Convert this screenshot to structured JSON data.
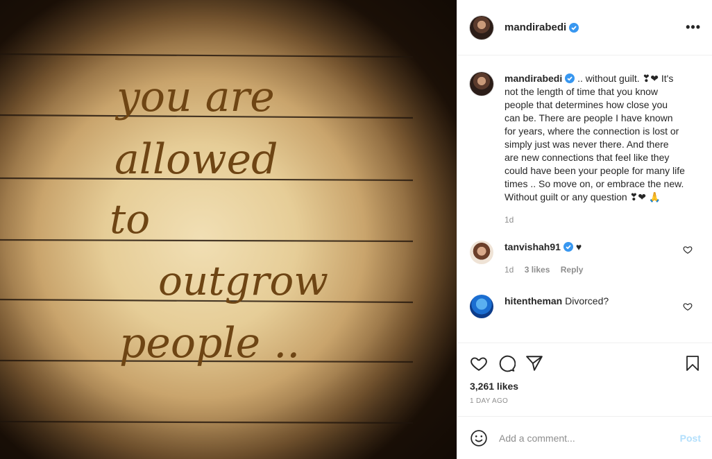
{
  "post": {
    "author": "mandirabedi",
    "more_label": "•••",
    "handwriting": [
      "you are",
      "allowed",
      "to",
      "outgrow",
      "people .."
    ],
    "caption": {
      "author": "mandirabedi",
      "text": " .. without guilt. ❣❤ It's not the length of time that you know people that determines how close you can be. There are people I have known for years, where the connection is lost or simply just was never there. And there are new connections that feel like they could have been your people for many life times .. So move on, or embrace the new. Without guilt or any question ❣❤ 🙏",
      "time": "1d"
    },
    "comments": [
      {
        "user": "tanvishah91",
        "text": " ♥",
        "time": "1d",
        "likes": "3 likes",
        "reply": "Reply"
      },
      {
        "user": "hitentheman",
        "text": " Divorced?"
      }
    ],
    "likes": "3,261 likes",
    "ago": "1 DAY AGO",
    "add_comment": {
      "placeholder": "Add a comment...",
      "post_label": "Post"
    }
  },
  "colors": {
    "verified": "#3897f0",
    "post_disabled": "#b2dffc",
    "muted": "#8e8e8e"
  },
  "icons": [
    "verified-icon",
    "more-options-icon",
    "heart-icon",
    "comment-icon",
    "share-icon",
    "bookmark-icon",
    "emoji-icon"
  ]
}
